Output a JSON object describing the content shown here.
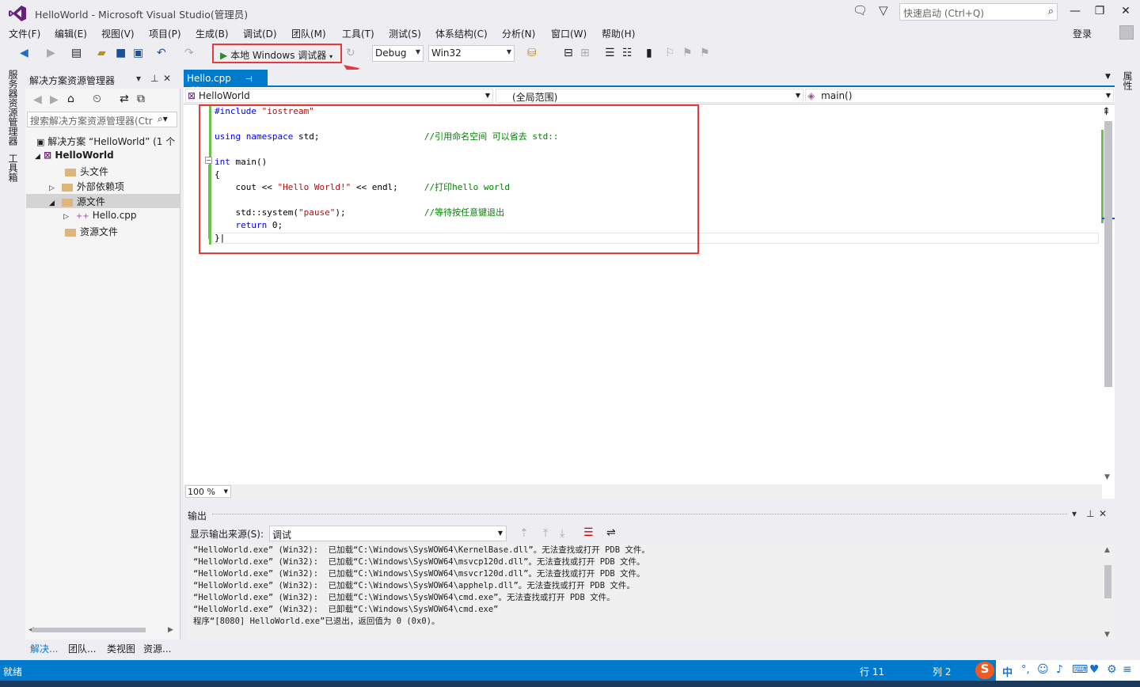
{
  "window": {
    "title": "HelloWorld - Microsoft Visual Studio(管理员)",
    "quick_launch_placeholder": "快速启动 (Ctrl+Q)",
    "login": "登录"
  },
  "menu": [
    "文件(F)",
    "编辑(E)",
    "视图(V)",
    "项目(P)",
    "生成(B)",
    "调试(D)",
    "团队(M)",
    "工具(T)",
    "测试(S)",
    "体系结构(C)",
    "分析(N)",
    "窗口(W)",
    "帮助(H)"
  ],
  "toolbar": {
    "debugger_label": "本地 Windows 调试器",
    "config": "Debug",
    "platform": "Win32"
  },
  "left_strip": {
    "server_explorer": "服务器资源管理器",
    "toolbox": "工具箱"
  },
  "right_strip": {
    "properties": "属性"
  },
  "solution_explorer": {
    "title": "解决方案资源管理器",
    "search_placeholder": "搜索解决方案资源管理器(Ctr",
    "tree": [
      {
        "label": "解决方案 “HelloWorld” (1 个",
        "indent": 0
      },
      {
        "label": "HelloWorld",
        "indent": 1
      },
      {
        "label": "头文件",
        "indent": 2
      },
      {
        "label": "外部依赖项",
        "indent": 2
      },
      {
        "label": "源文件",
        "indent": 2
      },
      {
        "label": "Hello.cpp",
        "indent": 3
      },
      {
        "label": "资源文件",
        "indent": 2
      }
    ],
    "bottom_tabs": [
      "解决...",
      "团队...",
      "类视图",
      "资源..."
    ]
  },
  "editor": {
    "tab_label": "Hello.cpp",
    "nav_project": "HelloWorld",
    "nav_scope": "(全局范围)",
    "nav_member": "main()",
    "zoom": "100 %"
  },
  "output": {
    "title": "输出",
    "source_label": "显示输出来源(S):",
    "source_value": "调试",
    "lines": [
      "“HelloWorld.exe” (Win32):  已加载“C:\\Windows\\SysWOW64\\KernelBase.dll”。无法查找或打开 PDB 文件。",
      "“HelloWorld.exe” (Win32):  已加载“C:\\Windows\\SysWOW64\\msvcp120d.dll”。无法查找或打开 PDB 文件。",
      "“HelloWorld.exe” (Win32):  已加载“C:\\Windows\\SysWOW64\\msvcr120d.dll”。无法查找或打开 PDB 文件。",
      "“HelloWorld.exe” (Win32):  已加载“C:\\Windows\\SysWOW64\\apphelp.dll”。无法查找或打开 PDB 文件。",
      "“HelloWorld.exe” (Win32):  已加载“C:\\Windows\\SysWOW64\\cmd.exe”。无法查找或打开 PDB 文件。",
      "“HelloWorld.exe” (Win32):  已卸载“C:\\Windows\\SysWOW64\\cmd.exe”",
      "程序“[8080] HelloWorld.exe”已退出，返回值为 0 (0x0)。"
    ]
  },
  "status": {
    "ready": "就绪",
    "line": "行 11",
    "col": "列 2",
    "ime": "中"
  },
  "colors": {
    "accent": "#007acc",
    "highlight_box": "#e63a3a",
    "keyword": "#0000ff",
    "string": "#a31515",
    "comment": "#008000"
  }
}
